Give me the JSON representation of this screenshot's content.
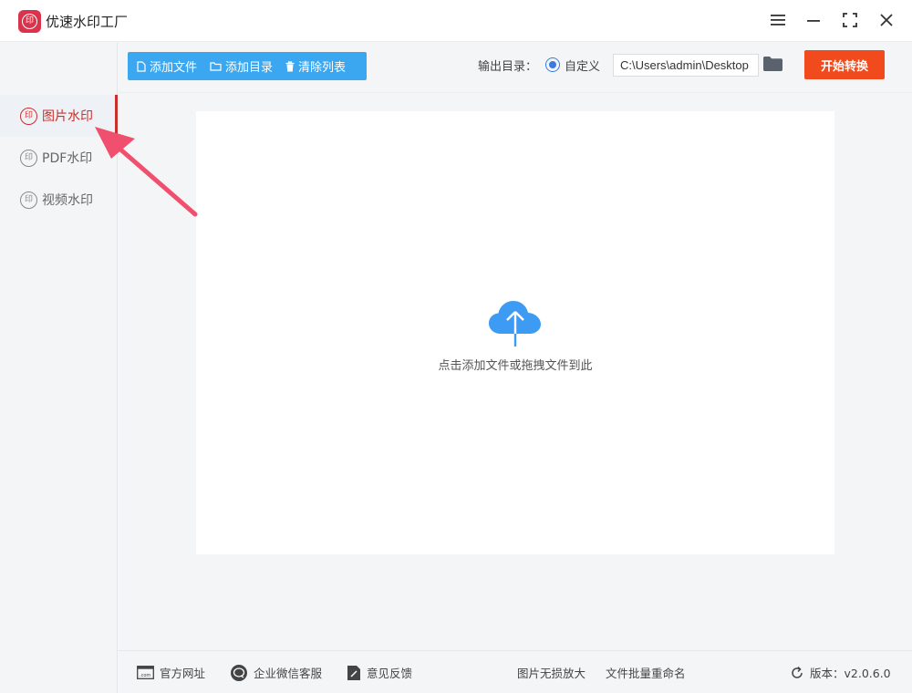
{
  "app": {
    "title": "优速水印工厂",
    "logo_glyph": "印"
  },
  "window_controls": [
    "menu-icon",
    "minimize-icon",
    "maximize-icon",
    "close-icon"
  ],
  "sidebar": {
    "items": [
      {
        "label": "图片水印",
        "active": true
      },
      {
        "label": "PDF水印",
        "active": false
      },
      {
        "label": "视频水印",
        "active": false
      }
    ]
  },
  "toolbar": {
    "add_file": "添加文件",
    "add_folder": "添加目录",
    "clear_list": "清除列表",
    "output_label": "输出目录：",
    "output_mode": "自定义",
    "output_path": "C:\\Users\\admin\\Desktop",
    "start": "开始转换"
  },
  "dropzone": {
    "text": "点击添加文件或拖拽文件到此"
  },
  "footer": {
    "website": "官方网址",
    "wechat": "企业微信客服",
    "feedback": "意见反馈",
    "upscale": "图片无损放大",
    "rename": "文件批量重命名",
    "version": "版本：v2.0.6.0"
  },
  "colors": {
    "accent": "#3ba7f0",
    "start_button": "#f04a1d",
    "active_sidebar": "#c9302c",
    "annotation_arrow": "#f0506e"
  }
}
